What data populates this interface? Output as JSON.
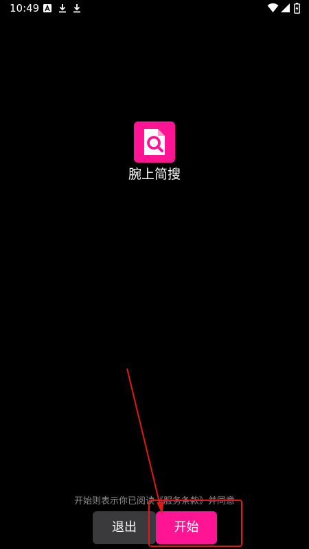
{
  "status_bar": {
    "time": "10:49",
    "icons_left": [
      "a-notification-icon",
      "download-icon",
      "download-icon"
    ],
    "icons_right": [
      "wifi-icon",
      "signal-icon",
      "battery-icon"
    ]
  },
  "app": {
    "icon": "search-document-icon",
    "name": "腕上简搜",
    "brand_color": "#ff1493"
  },
  "terms": {
    "prefix": "开始则表示你已阅读",
    "link": "《服务条款》",
    "suffix": "并同意"
  },
  "buttons": {
    "exit_label": "退出",
    "start_label": "开始"
  },
  "annotation": {
    "color": "#e01818"
  }
}
